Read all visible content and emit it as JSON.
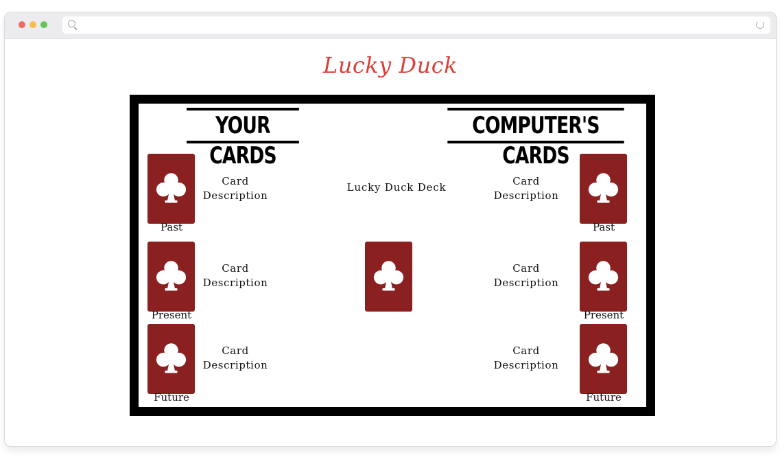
{
  "site": {
    "title": "Lucky Duck"
  },
  "board": {
    "player_header": "YOUR CARDS",
    "computer_header": "COMPUTER'S CARDS",
    "deck_label": "Lucky Duck Deck",
    "card_icon": "club-icon",
    "colors": {
      "card": "#8b2020",
      "title": "#d9403a",
      "frame": "#000000"
    },
    "player_cards": [
      {
        "label": "Past",
        "description": "Card Description"
      },
      {
        "label": "Present",
        "description": "Card Description"
      },
      {
        "label": "Future",
        "description": "Card Description"
      }
    ],
    "computer_cards": [
      {
        "label": "Past",
        "description": "Card Description"
      },
      {
        "label": "Present",
        "description": "Card Description"
      },
      {
        "label": "Future",
        "description": "Card Description"
      }
    ]
  }
}
